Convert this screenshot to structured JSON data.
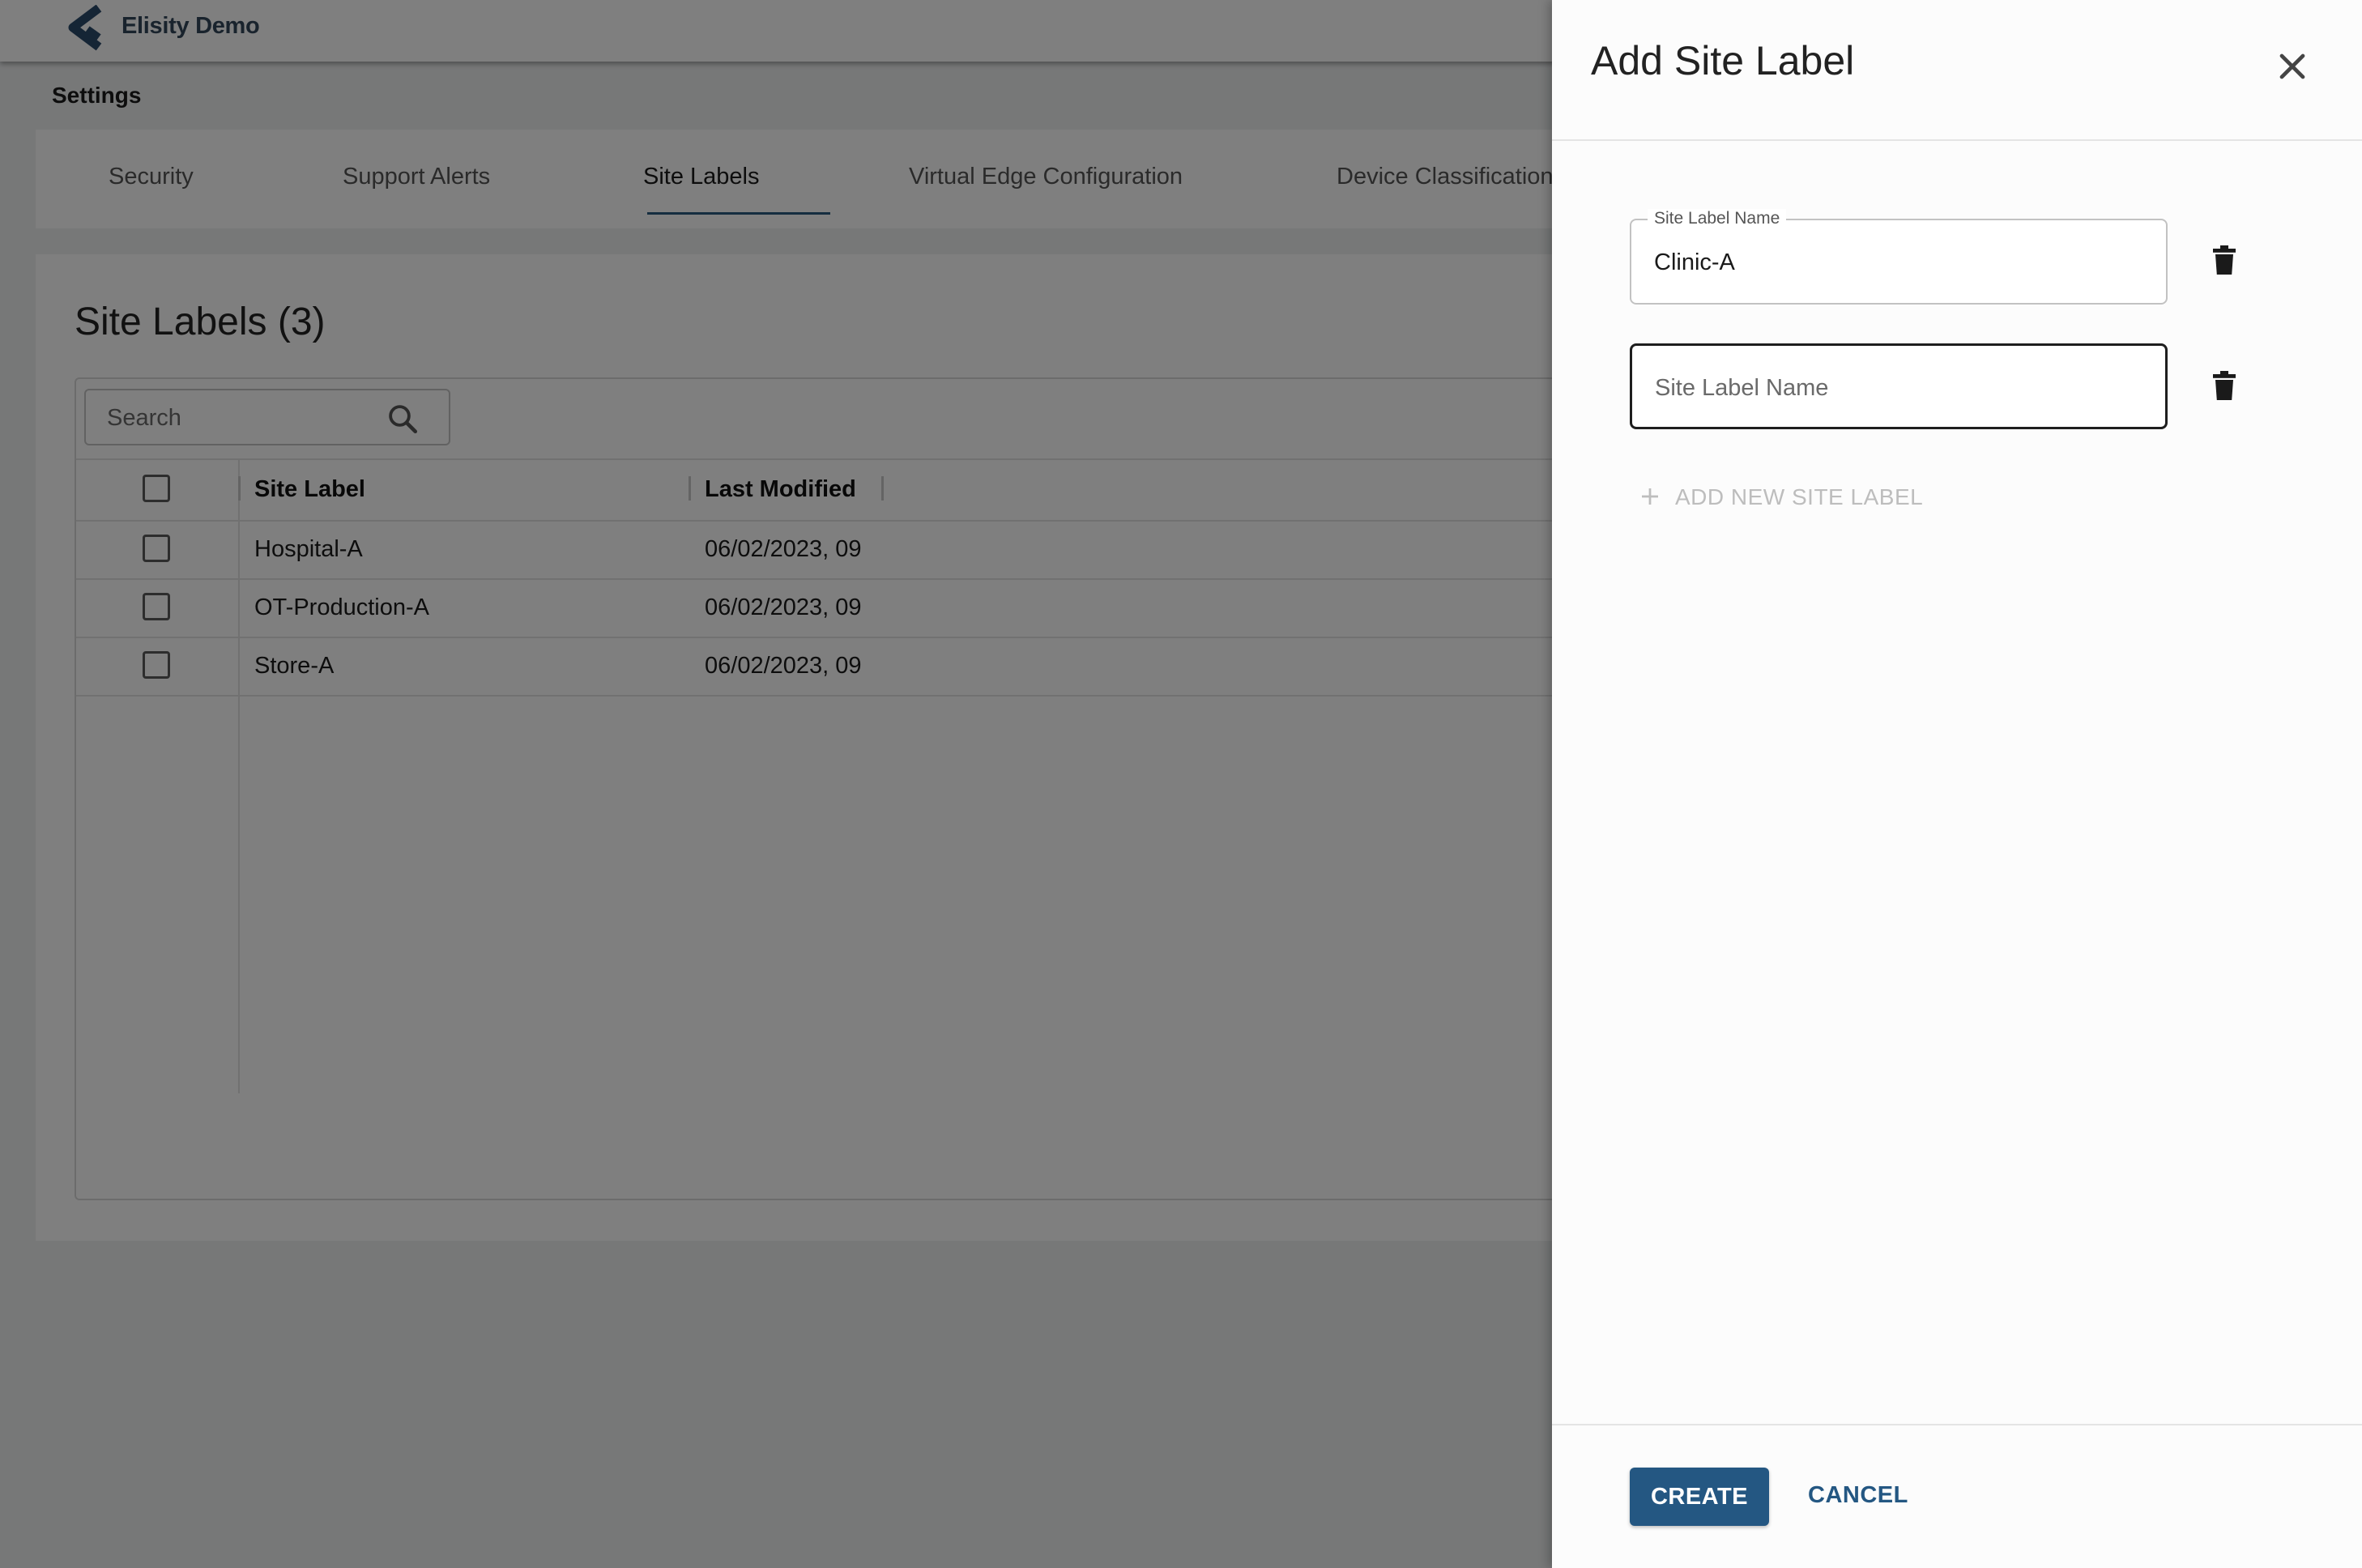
{
  "app": {
    "brand": "Elisity Demo",
    "page_title": "Settings"
  },
  "tabs": [
    {
      "label": "Security"
    },
    {
      "label": "Support Alerts"
    },
    {
      "label": "Site Labels",
      "active": true
    },
    {
      "label": "Virtual Edge Configuration"
    },
    {
      "label": "Device Classification"
    }
  ],
  "site_labels": {
    "title": "Site Labels (3)",
    "search_placeholder": "Search",
    "columns": [
      "Site Label",
      "Last Modified"
    ],
    "rows": [
      {
        "label": "Hospital-A",
        "modified": "06/02/2023, 09"
      },
      {
        "label": "OT-Production-A",
        "modified": "06/02/2023, 09"
      },
      {
        "label": "Store-A",
        "modified": "06/02/2023, 09"
      }
    ]
  },
  "drawer": {
    "title": "Add Site Label",
    "fields": [
      {
        "legend": "Site Label Name",
        "value": "Clinic-A"
      },
      {
        "placeholder": "Site Label Name",
        "value": ""
      }
    ],
    "add_new_label": "ADD NEW SITE LABEL",
    "create_label": "CREATE",
    "cancel_label": "CANCEL"
  },
  "colors": {
    "accent": "#245782",
    "overlay": "rgba(0,0,0,0.5)"
  },
  "icons": [
    "elisity-logo-icon",
    "search-icon",
    "close-icon",
    "trash-icon",
    "plus-icon"
  ]
}
